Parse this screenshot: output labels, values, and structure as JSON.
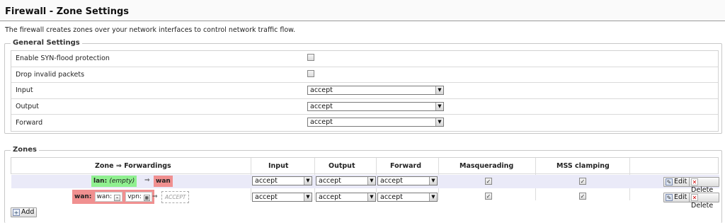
{
  "page": {
    "title": "Firewall - Zone Settings",
    "description": "The firewall creates zones over your network interfaces to control network traffic flow."
  },
  "general": {
    "legend": "General Settings",
    "rows": [
      {
        "label": "Enable SYN-flood protection",
        "type": "checkbox",
        "checked": false
      },
      {
        "label": "Drop invalid packets",
        "type": "checkbox",
        "checked": false
      },
      {
        "label": "Input",
        "type": "select",
        "value": "accept"
      },
      {
        "label": "Output",
        "type": "select",
        "value": "accept"
      },
      {
        "label": "Forward",
        "type": "select",
        "value": "accept"
      }
    ]
  },
  "zones": {
    "legend": "Zones",
    "headers": {
      "forwardings": "Zone ⇒ Forwardings",
      "input": "Input",
      "output": "Output",
      "forward": "Forward",
      "masquerading": "Masquerading",
      "mss": "MSS clamping"
    },
    "rows": [
      {
        "zone": "lan:",
        "zone_detail": "(empty)",
        "arrow": "⇒",
        "target": "wan",
        "input": "accept",
        "output": "accept",
        "forward": "accept",
        "masquerading": true,
        "mss": true,
        "edit_label": "Edit",
        "delete_label": "Delete"
      },
      {
        "zone": "wan:",
        "networks": [
          "wan:",
          "vpn:"
        ],
        "arrow": "⇒",
        "target": "ACCEPT",
        "input": "accept",
        "output": "accept",
        "forward": "accept",
        "masquerading": true,
        "mss": true,
        "edit_label": "Edit",
        "delete_label": "Delete"
      }
    ],
    "add_label": "Add"
  },
  "colors": {
    "lan_zone": "#90f090",
    "wan_zone": "#f09090",
    "row_highlight": "#eaeaf8"
  }
}
